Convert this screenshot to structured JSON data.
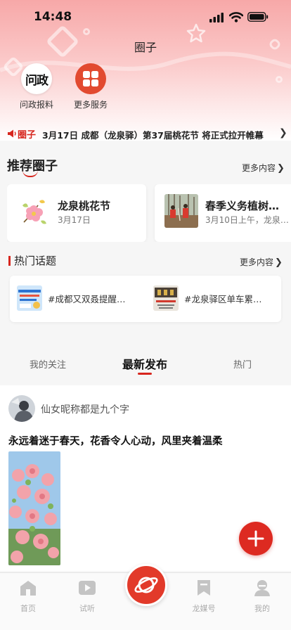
{
  "status_bar": {
    "time": "14:48"
  },
  "header": {
    "title": "圈子"
  },
  "services": [
    {
      "label": "问政报料",
      "glyph": "问政",
      "icon": "wenzheng-logo"
    },
    {
      "label": "更多服务",
      "icon": "grid-icon"
    }
  ],
  "ticker": {
    "tag": "圈子",
    "text": "3月17日 成都（龙泉驿）第37届桃花节 将正式拉开帷幕",
    "icon": "speaker-icon"
  },
  "recommended": {
    "title": "推荐圈子",
    "more_label": "更多内容",
    "items": [
      {
        "name": "龙泉桃花节",
        "date": "3月17日"
      },
      {
        "name": "春季义务植树…",
        "date": "3月10日上午，龙泉…"
      }
    ]
  },
  "hot_topics": {
    "title": "热门话题",
    "more_label": "更多内容",
    "items": [
      {
        "text": "#成都又双叒提醒…"
      },
      {
        "text": "#龙泉驿区单车累…"
      }
    ]
  },
  "feed_tabs": {
    "follow": "我的关注",
    "latest": "最新发布",
    "hot": "热门",
    "active": "latest"
  },
  "post": {
    "author": "仙女昵称都是九个字",
    "content": "永远着迷于春天，花香令人心动，风里夹着温柔"
  },
  "tabbar": {
    "items": [
      {
        "label": "首页",
        "icon": "home-icon"
      },
      {
        "label": "试听",
        "icon": "play-icon"
      },
      {
        "label": "",
        "icon": "planet-icon"
      },
      {
        "label": "龙媒号",
        "icon": "bookmark-icon"
      },
      {
        "label": "我的",
        "icon": "user-icon"
      }
    ]
  },
  "colors": {
    "accent": "#d7261e",
    "header_gradient_top": "#f7a8a8"
  }
}
